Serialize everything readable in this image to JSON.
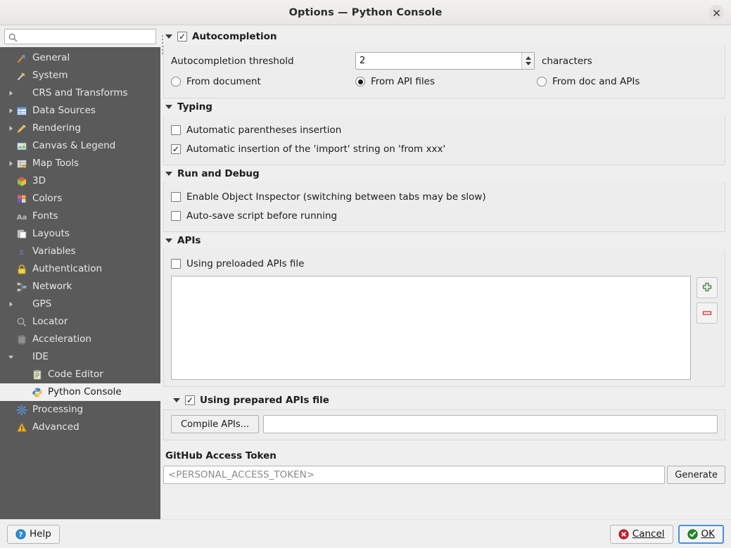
{
  "window": {
    "title": "Options — Python Console",
    "close_icon": "close-icon"
  },
  "sidebar": {
    "search": {
      "value": "",
      "placeholder": "",
      "icon": "search-icon"
    },
    "items": [
      {
        "label": "General",
        "icon": "hammer-wrench-icon",
        "expandable": false,
        "child": false,
        "selected": false
      },
      {
        "label": "System",
        "icon": "system-tools-icon",
        "expandable": false,
        "child": false,
        "selected": false
      },
      {
        "label": "CRS and Transforms",
        "icon": "none",
        "expandable": true,
        "child": false,
        "selected": false
      },
      {
        "label": "Data Sources",
        "icon": "table-icon",
        "expandable": true,
        "child": false,
        "selected": false
      },
      {
        "label": "Rendering",
        "icon": "paintbrush-icon",
        "expandable": true,
        "child": false,
        "selected": false
      },
      {
        "label": "Canvas & Legend",
        "icon": "map-canvas-icon",
        "expandable": false,
        "child": false,
        "selected": false
      },
      {
        "label": "Map Tools",
        "icon": "map-tools-icon",
        "expandable": true,
        "child": false,
        "selected": false
      },
      {
        "label": "3D",
        "icon": "cube-3d-icon",
        "expandable": false,
        "child": false,
        "selected": false
      },
      {
        "label": "Colors",
        "icon": "color-palette-icon",
        "expandable": false,
        "child": false,
        "selected": false
      },
      {
        "label": "Fonts",
        "icon": "font-aa-icon",
        "expandable": false,
        "child": false,
        "selected": false
      },
      {
        "label": "Layouts",
        "icon": "layouts-icon",
        "expandable": false,
        "child": false,
        "selected": false
      },
      {
        "label": "Variables",
        "icon": "epsilon-icon",
        "expandable": false,
        "child": false,
        "selected": false
      },
      {
        "label": "Authentication",
        "icon": "lock-icon",
        "expandable": false,
        "child": false,
        "selected": false
      },
      {
        "label": "Network",
        "icon": "network-icon",
        "expandable": false,
        "child": false,
        "selected": false
      },
      {
        "label": "GPS",
        "icon": "none",
        "expandable": true,
        "child": false,
        "selected": false
      },
      {
        "label": "Locator",
        "icon": "locator-search-icon",
        "expandable": false,
        "child": false,
        "selected": false
      },
      {
        "label": "Acceleration",
        "icon": "acceleration-icon",
        "expandable": false,
        "child": false,
        "selected": false
      },
      {
        "label": "IDE",
        "icon": "none",
        "expandable": true,
        "expanded": true,
        "child": false,
        "selected": false
      },
      {
        "label": "Code Editor",
        "icon": "code-editor-icon",
        "expandable": false,
        "child": true,
        "selected": false
      },
      {
        "label": "Python Console",
        "icon": "python-icon",
        "expandable": false,
        "child": true,
        "selected": true
      },
      {
        "label": "Processing",
        "icon": "gear-icon",
        "expandable": false,
        "child": false,
        "selected": false
      },
      {
        "label": "Advanced",
        "icon": "warning-icon",
        "expandable": false,
        "child": false,
        "selected": false
      }
    ]
  },
  "autocompletion": {
    "title": "Autocompletion",
    "checked": true,
    "threshold_label": "Autocompletion threshold",
    "threshold_value": "2",
    "characters_label": "characters",
    "source_options": [
      {
        "label": "From document",
        "selected": false
      },
      {
        "label": "From API files",
        "selected": true
      },
      {
        "label": "From doc and APIs",
        "selected": false
      }
    ]
  },
  "typing": {
    "title": "Typing",
    "options": [
      {
        "label": "Automatic parentheses insertion",
        "checked": false
      },
      {
        "label": "Automatic insertion of the 'import' string on 'from xxx'",
        "checked": true
      }
    ]
  },
  "run_and_debug": {
    "title": "Run and Debug",
    "options": [
      {
        "label": "Enable Object Inspector (switching between tabs may be slow)",
        "checked": false
      },
      {
        "label": "Auto-save script before running",
        "checked": false
      }
    ]
  },
  "apis": {
    "title": "APIs",
    "preloaded_label": "Using preloaded APIs file",
    "preloaded_checked": false,
    "list_items": [],
    "add_button_icon": "add-plus-icon",
    "remove_button_icon": "remove-minus-icon",
    "prepared_label": "Using prepared APIs file",
    "prepared_checked": true,
    "compile_button_label": "Compile APIs...",
    "compile_path_value": ""
  },
  "github": {
    "title": "GitHub Access Token",
    "token_value": "",
    "token_placeholder": "<PERSONAL_ACCESS_TOKEN>",
    "generate_label": "Generate"
  },
  "footer": {
    "help_label": "Help",
    "cancel_label": "Cancel",
    "ok_label": "OK"
  },
  "colors": {
    "sidebar_bg": "#5a5a5a",
    "dialog_bg": "#efefef",
    "selected_row": "#f0f0f0",
    "focus_blue": "#4a90d9",
    "ok_green": "#1e8b28",
    "cancel_red": "#c8232c",
    "help_blue": "#2a8fd4"
  }
}
